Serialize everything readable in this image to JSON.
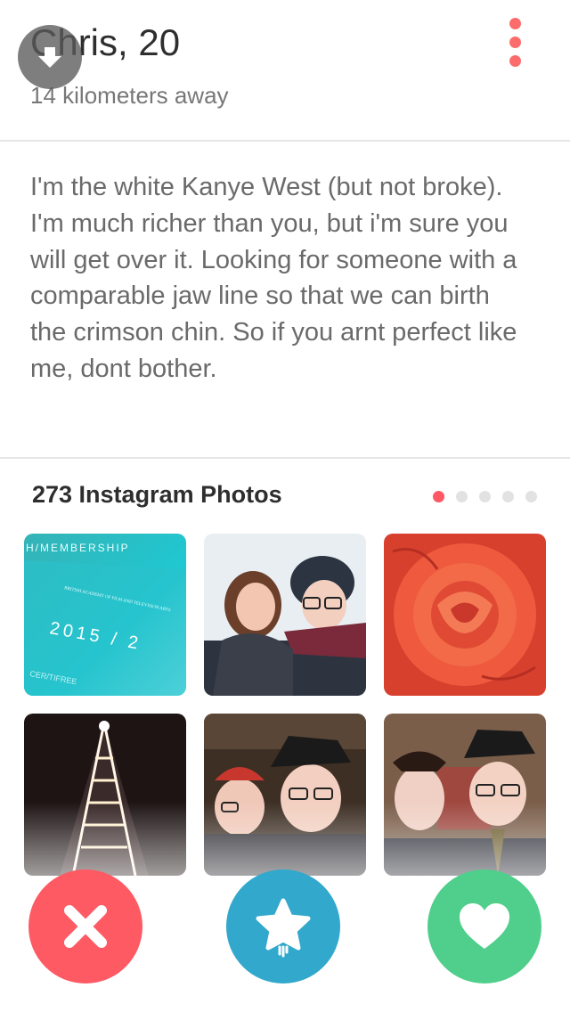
{
  "profile": {
    "name": "Chris",
    "age": "20",
    "name_line": "Chris, 20",
    "distance": "14 kilometers away"
  },
  "bio": "I'm the white Kanye West (but not broke). I'm much richer than you, but i'm sure you will get over it. Looking for someone with a comparable jaw line so that we can birth the crimson chin. So if you arnt perfect like me, dont bother.",
  "instagram": {
    "title": "273 Instagram Photos",
    "page_count": 5,
    "active_page": 1
  },
  "photo1_text": {
    "banner": "H/MEMBERSHIP",
    "org": "BRITISH ACADEMY OF FILM AND TELEVISION ARTS",
    "year": "2015 / 2",
    "footer": "CER/TIFREE"
  },
  "icons": {
    "back": "chevron-down-icon",
    "more": "more-vertical-icon",
    "nope": "close-icon",
    "superlike": "star-icon",
    "like": "heart-icon"
  },
  "colors": {
    "nope": "#fd5a64",
    "superlike": "#31a8cc",
    "like": "#4fcf8b",
    "accent": "#fd6c6c"
  }
}
